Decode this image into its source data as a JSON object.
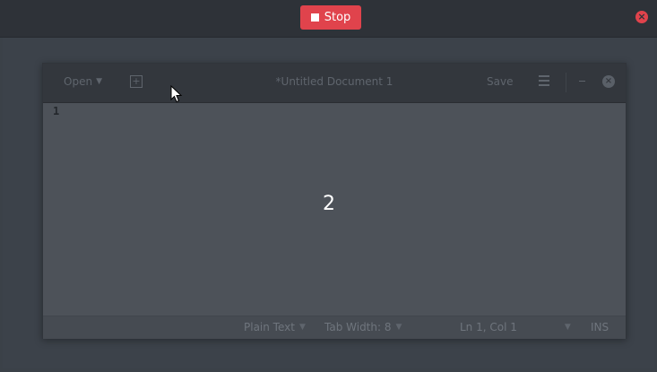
{
  "topbar": {
    "stop_label": "Stop",
    "stop_color": "#e0434c"
  },
  "editor": {
    "header": {
      "open_label": "Open",
      "title": "*Untitled Document 1",
      "save_label": "Save"
    },
    "text_area": {
      "line_number": "1",
      "overlay_number": "2"
    },
    "status_bar": {
      "language": "Plain Text",
      "tab_width": "Tab Width: 8",
      "position": "Ln 1, Col 1",
      "mode": "INS"
    }
  },
  "icons": {
    "stop": "stop-square-icon",
    "close": "close-icon",
    "new_tab": "new-tab-icon",
    "menu": "hamburger-menu-icon",
    "minimize": "minimize-icon",
    "cursor": "mouse-pointer-icon"
  }
}
